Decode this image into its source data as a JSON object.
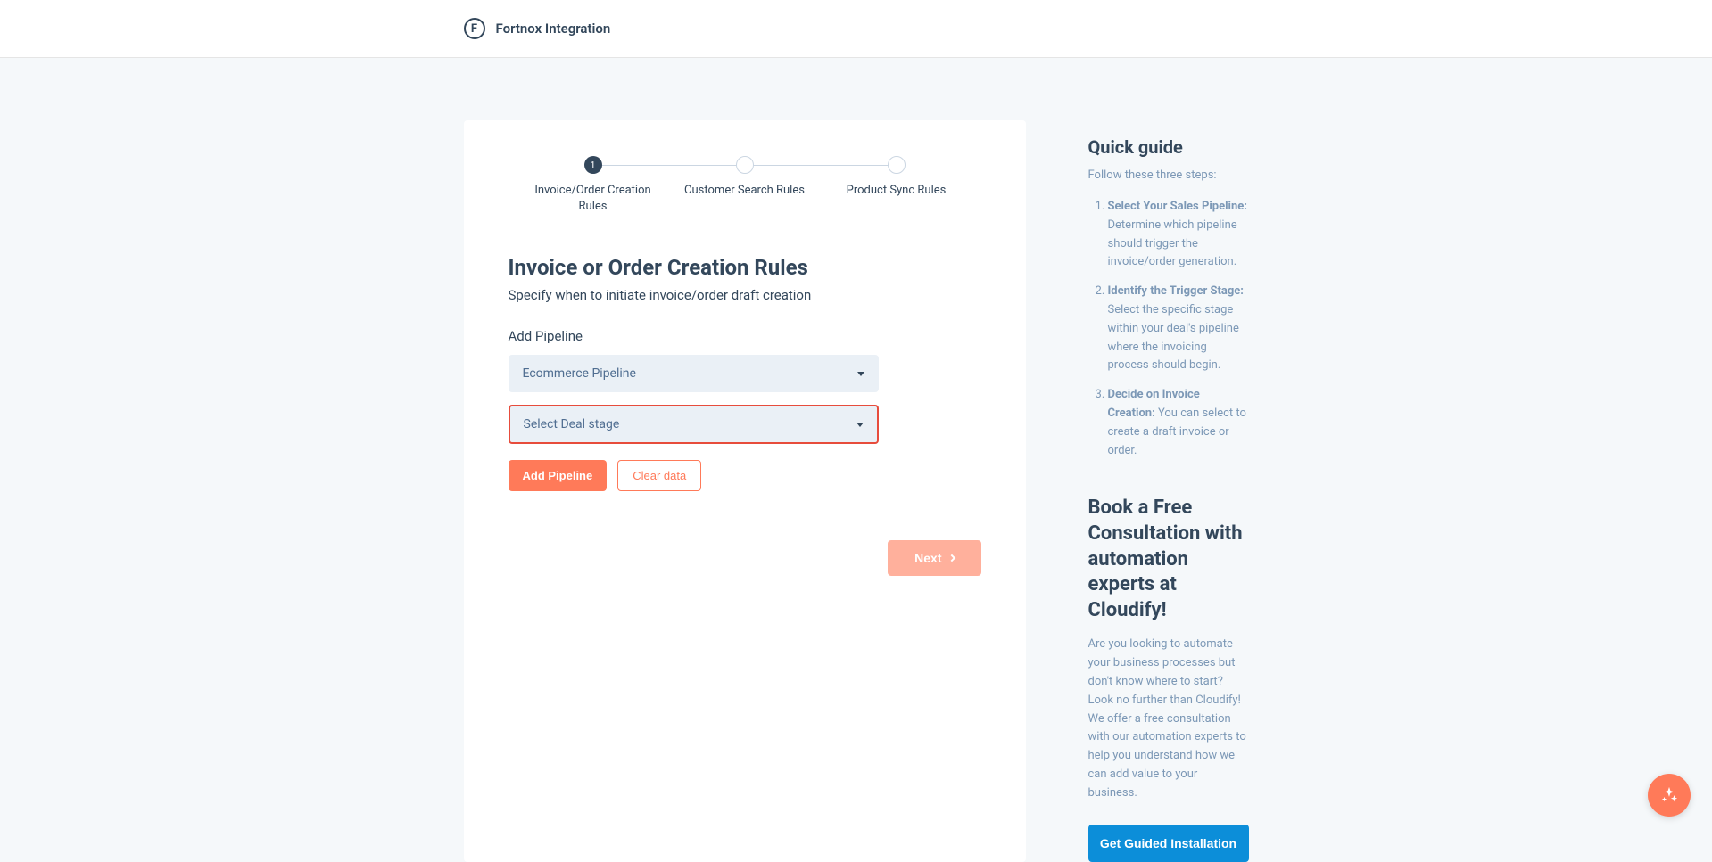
{
  "header": {
    "logo_letter": "F",
    "title": "Fortnox Integration"
  },
  "stepper": {
    "steps": [
      {
        "number": "1",
        "label": "Invoice/Order Creation Rules",
        "active": true
      },
      {
        "label": "Customer Search Rules",
        "active": false
      },
      {
        "label": "Product Sync Rules",
        "active": false
      }
    ]
  },
  "main": {
    "title": "Invoice or Order Creation Rules",
    "subtitle": "Specify when to initiate invoice/order draft creation",
    "pipeline_label": "Add Pipeline",
    "pipeline_selected": "Ecommerce Pipeline",
    "dealstage_placeholder": "Select Deal stage",
    "add_pipeline_btn": "Add Pipeline",
    "clear_data_btn": "Clear data",
    "next_btn": "Next"
  },
  "guide": {
    "title": "Quick guide",
    "intro": "Follow these three steps:",
    "items": [
      {
        "bold": "Select Your Sales Pipeline:",
        "text": " Determine which pipeline should trigger the invoice/order generation."
      },
      {
        "bold": "Identify the Trigger Stage:",
        "text": " Select the specific stage within your deal's pipeline where the invoicing process should begin."
      },
      {
        "bold": "Decide on Invoice Creation:",
        "text": " You can select to create a draft invoice or order."
      }
    ]
  },
  "consult": {
    "title": "Book a Free Consultation with automation experts at Cloudify!",
    "text": "Are you looking to automate your business processes but don't know where to start? Look no further than Cloudify! We offer a free consultation with our automation experts to help you understand how we can add value to your business.",
    "button": "Get Guided Installation"
  }
}
